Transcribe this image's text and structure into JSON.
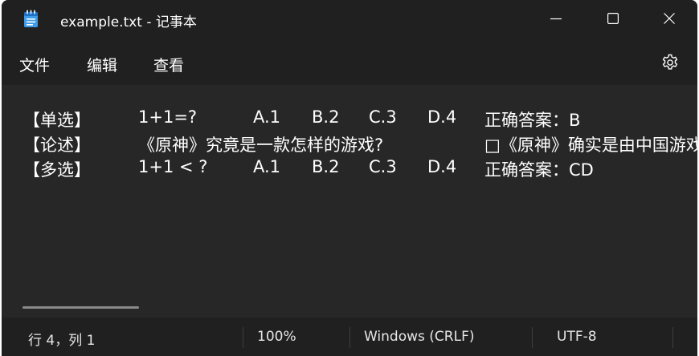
{
  "window": {
    "title": "example.txt - 记事本",
    "app_icon": "notepad-icon",
    "controls": [
      "minimize-icon",
      "maximize-icon",
      "close-icon"
    ]
  },
  "menu": {
    "file": "文件",
    "edit": "编辑",
    "view": "查看",
    "settings_icon": "gear-icon"
  },
  "editor": {
    "lines": [
      {
        "tag": "【单选】",
        "question": "1+1=?",
        "a": "A.1",
        "b": "B.2",
        "c": "C.3",
        "d": "D.4",
        "answer": "正确答案：B"
      },
      {
        "tag": "【论述】",
        "question": "《原神》究竟是一款怎样的游戏?",
        "answer": "□《原神》确实是由中国游戏"
      },
      {
        "tag": "【多选】",
        "question": "1+1 < ?",
        "a": "A.1",
        "b": "B.2",
        "c": "C.3",
        "d": "D.4",
        "answer": "正确答案：CD"
      }
    ]
  },
  "status": {
    "position": "行 4，列 1",
    "zoom": "100%",
    "line_ending": "Windows (CRLF)",
    "encoding": "UTF-8"
  },
  "colors": {
    "titlebar": "#202020",
    "editor_bg": "#272727",
    "text": "#ffffff"
  }
}
